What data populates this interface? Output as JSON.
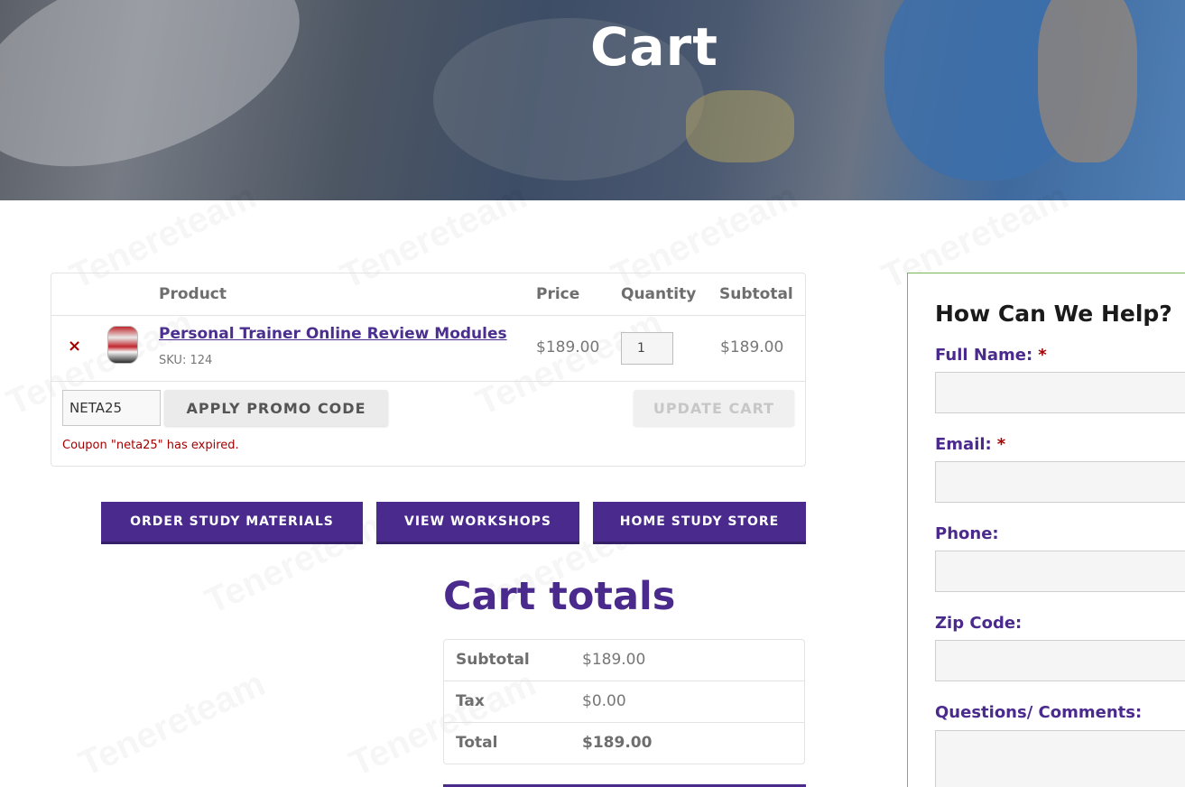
{
  "hero": {
    "title": "Cart"
  },
  "watermark": {
    "text": "Tenereteam"
  },
  "cart": {
    "headers": {
      "product": "Product",
      "price": "Price",
      "quantity": "Quantity",
      "subtotal": "Subtotal"
    },
    "item": {
      "remove_symbol": "×",
      "name": "Personal Trainer Online Review Modules",
      "sku": "SKU: 124",
      "price": "$189.00",
      "quantity": "1",
      "subtotal": "$189.00"
    },
    "coupon_value": "NETA25",
    "apply_label": "APPLY PROMO CODE",
    "update_label": "UPDATE CART",
    "coupon_error": "Coupon \"neta25\" has expired."
  },
  "actions": {
    "order_study": "ORDER STUDY MATERIALS",
    "view_workshops": "VIEW WORKSHOPS",
    "home_study": "HOME STUDY STORE"
  },
  "totals": {
    "title": "Cart totals",
    "rows": [
      {
        "label": "Subtotal",
        "value": "$189.00"
      },
      {
        "label": "Tax",
        "value": "$0.00"
      },
      {
        "label": "Total",
        "value": "$189.00"
      }
    ]
  },
  "help": {
    "title": "How Can We Help?",
    "full_name": "Full Name:",
    "email": "Email:",
    "phone": "Phone:",
    "zip": "Zip Code:",
    "comments": "Questions/ Comments:",
    "required_mark": "*"
  },
  "colors": {
    "brand_purple": "#4b2a8e",
    "error_red": "#a40000",
    "panel_border": "#7ab55c"
  }
}
